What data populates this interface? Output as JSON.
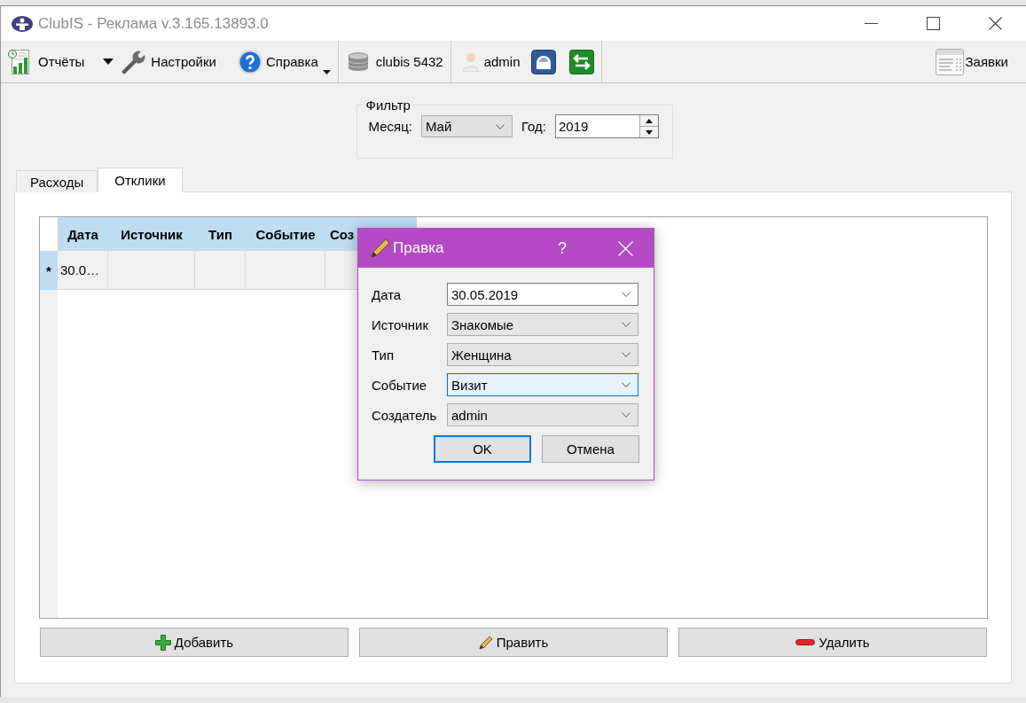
{
  "window": {
    "title": "ClubIS - Реклама v.3.165.13893.0"
  },
  "toolbar": {
    "reports": "Отчёты",
    "settings": "Настройки",
    "help": "Справка",
    "database": "clubis 5432",
    "user": "admin",
    "requests": "Заявки"
  },
  "filter": {
    "title": "Фильтр",
    "month_label": "Месяц:",
    "month": "Май",
    "year_label": "Год:",
    "year": "2019"
  },
  "tabs": [
    {
      "label": "Расходы",
      "selected": false
    },
    {
      "label": "Отклики",
      "selected": true
    }
  ],
  "table": {
    "columns": [
      "Дата",
      "Источник",
      "Тип",
      "Событие",
      "Соз"
    ],
    "rows": [
      {
        "marker": "*",
        "selected": true,
        "cells": [
          "30.0…"
        ]
      }
    ]
  },
  "actions": [
    "Добавить",
    "Править",
    "Удалить"
  ],
  "dialog": {
    "title": "Правка",
    "help": "?",
    "fields": [
      {
        "label": "Дата",
        "value": "30.05.2019",
        "kind": "date",
        "focused": false
      },
      {
        "label": "Источник",
        "value": "Знакомые",
        "kind": "combo",
        "focused": false
      },
      {
        "label": "Тип",
        "value": "Женщина",
        "kind": "combo",
        "focused": false
      },
      {
        "label": "Событие",
        "value": "Визит",
        "kind": "combo",
        "focused": true
      },
      {
        "label": "Создатель",
        "value": "admin",
        "kind": "combo",
        "focused": false
      }
    ],
    "buttons": [
      {
        "label": "OK",
        "default": true
      },
      {
        "label": "Отмена",
        "default": false
      }
    ]
  }
}
